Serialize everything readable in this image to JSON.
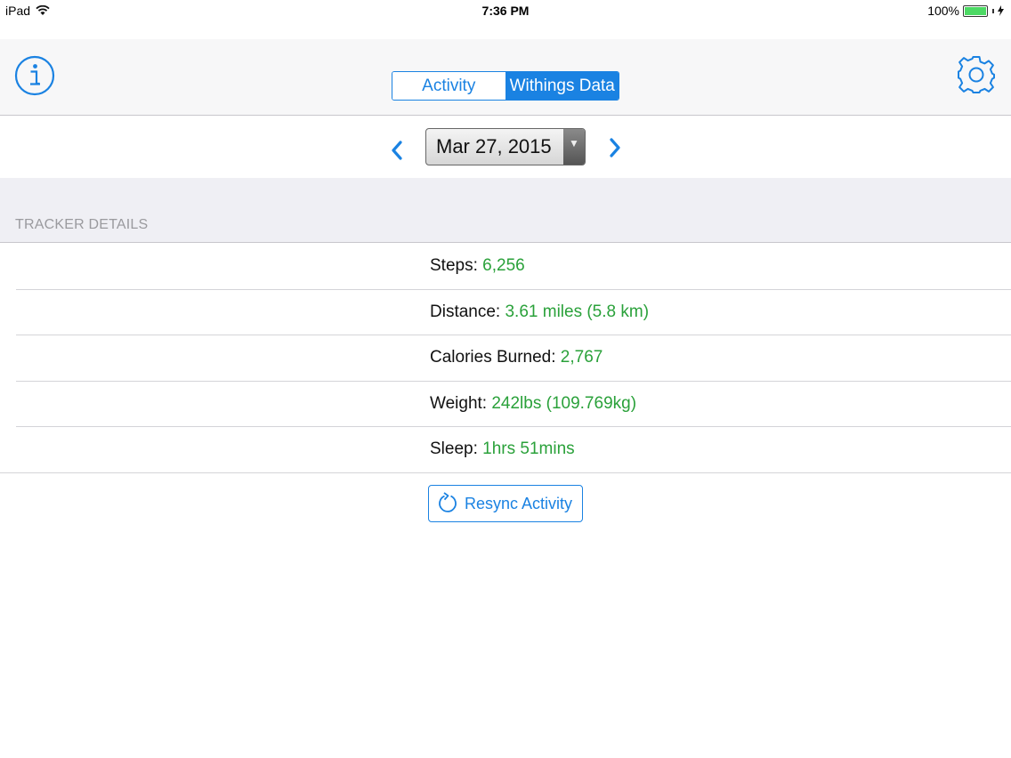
{
  "status_bar": {
    "device": "iPad",
    "time": "7:36 PM",
    "battery": "100%"
  },
  "nav": {
    "segments": [
      {
        "label": "Activity",
        "selected": false
      },
      {
        "label": "Withings Data",
        "selected": true
      }
    ],
    "info_icon": "info-icon",
    "settings_icon": "gear-icon"
  },
  "date_picker": {
    "value": "Mar 27, 2015"
  },
  "section": {
    "title": "TRACKER DETAILS"
  },
  "details": [
    {
      "label": "Steps: ",
      "value": "6,256"
    },
    {
      "label": "Distance: ",
      "value": "3.61 miles (5.8 km)"
    },
    {
      "label": "Calories Burned: ",
      "value": "2,767"
    },
    {
      "label": "Weight: ",
      "value": "242lbs (109.769kg)"
    },
    {
      "label": "Sleep: ",
      "value": "1hrs 51mins"
    }
  ],
  "resync": {
    "label": "Resync Activity",
    "icon": "refresh-icon"
  },
  "colors": {
    "accent": "#1a82e2",
    "value_green": "#2aa13a",
    "section_bg": "#efeff4"
  }
}
